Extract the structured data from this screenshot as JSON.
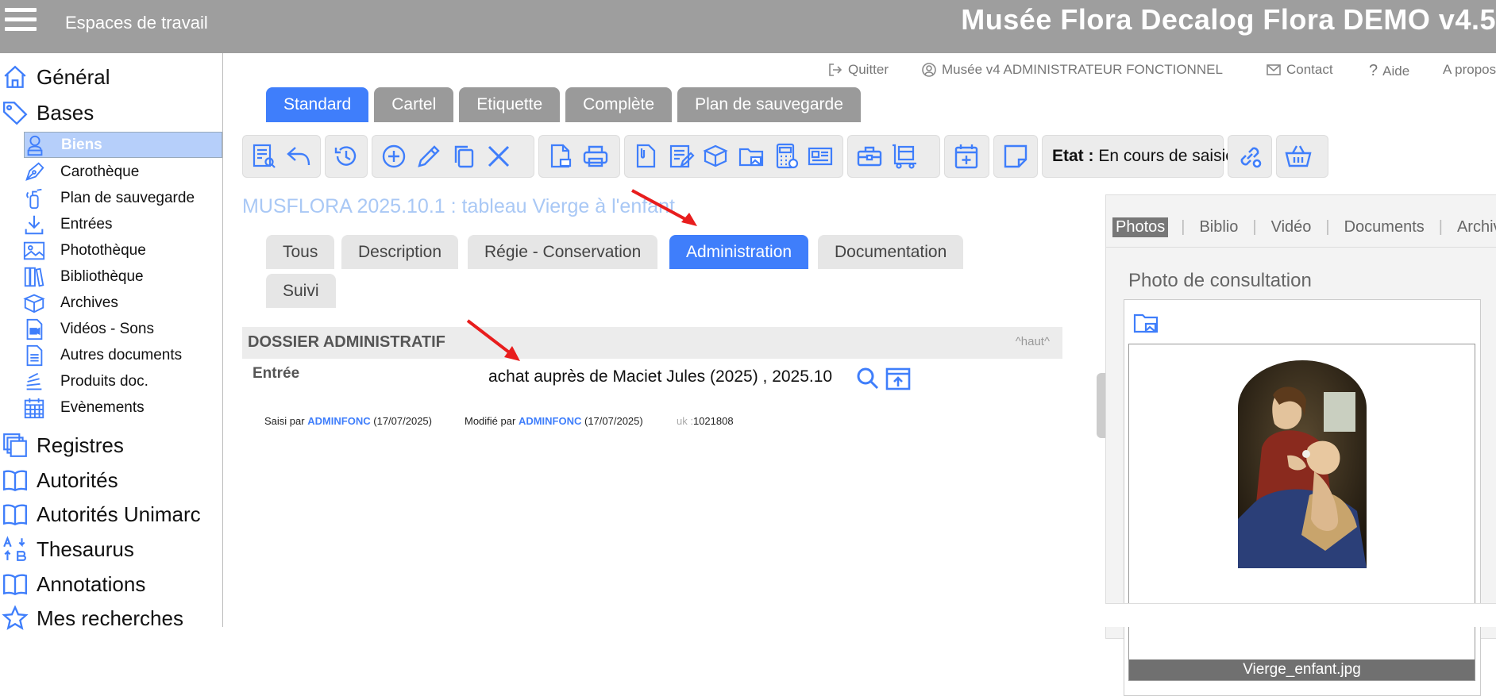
{
  "topbar": {
    "menu_icon": "hamburger-menu-icon",
    "workspaces": "Espaces de travail",
    "title": "Musée Flora Decalog Flora DEMO v4.5"
  },
  "sidebar": {
    "main1": [
      {
        "label": "Général",
        "icon": "home-icon"
      },
      {
        "label": "Bases",
        "icon": "tag-icon"
      }
    ],
    "subs": [
      {
        "label": "Biens",
        "icon": "bust-icon"
      },
      {
        "label": "Carothèque",
        "icon": "pen-nib-icon"
      },
      {
        "label": "Plan de sauvegarde",
        "icon": "fire-extinguisher-icon"
      },
      {
        "label": "Entrées",
        "icon": "download-icon"
      },
      {
        "label": "Photothèque",
        "icon": "image-icon"
      },
      {
        "label": "Bibliothèque",
        "icon": "books-icon"
      },
      {
        "label": "Archives",
        "icon": "box-icon"
      },
      {
        "label": "Vidéos - Sons",
        "icon": "video-icon"
      },
      {
        "label": "Autres documents",
        "icon": "document-icon"
      },
      {
        "label": "Produits doc.",
        "icon": "stack-icon"
      },
      {
        "label": "Evènements",
        "icon": "calendar-icon"
      }
    ],
    "main2": [
      {
        "label": "Registres",
        "icon": "registers-icon"
      },
      {
        "label": "Autorités",
        "icon": "book-icon"
      },
      {
        "label": "Autorités Unimarc",
        "icon": "book-icon"
      },
      {
        "label": "Thesaurus",
        "icon": "sort-az-icon"
      },
      {
        "label": "Annotations",
        "icon": "book-icon"
      },
      {
        "label": "Mes recherches",
        "icon": "star-icon"
      }
    ]
  },
  "header_links": {
    "quit": "Quitter",
    "user": "Musée v4 ADMINISTRATEUR FONCTIONNEL",
    "contact": "Contact",
    "help": "Aide",
    "about": "A propos"
  },
  "view_tabs": [
    "Standard",
    "Cartel",
    "Etiquette",
    "Complète",
    "Plan de sauvegarde"
  ],
  "toolbar": {
    "etat_label": "Etat :",
    "etat_value": "En cours de saisie"
  },
  "record_title": "MUSFLORA 2025.10.1 : tableau Vierge à l'enfant",
  "field_tabs": [
    "Tous",
    "Description",
    "Régie - Conservation",
    "Administration",
    "Documentation",
    "Suivi"
  ],
  "section": {
    "title": "DOSSIER ADMINISTRATIF",
    "top_link": "^haut^"
  },
  "entry": {
    "label": "Entrée",
    "value": "achat auprès de Maciet Jules (2025) , 2025.10"
  },
  "meta": {
    "saisi_label": "Saisi par",
    "saisi_user": "ADMINFONC",
    "saisi_date": "(17/07/2025)",
    "modif_label": "Modifié par",
    "modif_user": "ADMINFONC",
    "modif_date": "(17/07/2025)",
    "uk_label": "uk :",
    "uk_value": "1021808"
  },
  "right_panel": {
    "tabs": [
      "Photos",
      "Biblio",
      "Vidéo",
      "Documents",
      "Archives"
    ],
    "heading": "Photo de consultation",
    "caption": "Vierge_enfant.jpg"
  },
  "colors": {
    "accent": "#3f7efb",
    "topbar": "#9e9e9e",
    "selected": "#b6cffa"
  }
}
